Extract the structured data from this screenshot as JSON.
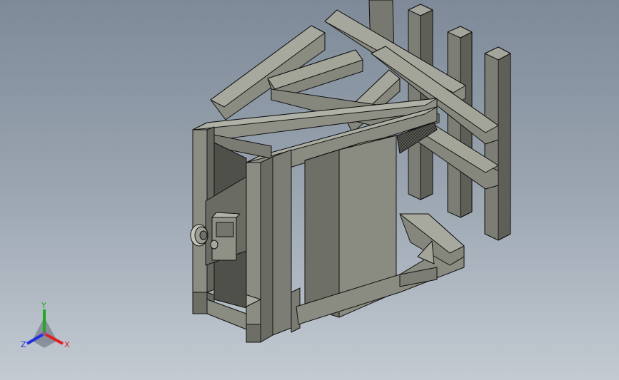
{
  "viewport": {
    "background_top": "#7e8a98",
    "background_bottom": "#c3cad2",
    "model_face_color": "#86877d",
    "model_edge_color": "#111111"
  },
  "triad": {
    "x_label": "X",
    "y_label": "Y",
    "z_label": "Z",
    "x_color": "#e02020",
    "y_color": "#1faa1f",
    "z_color": "#2030e0"
  }
}
